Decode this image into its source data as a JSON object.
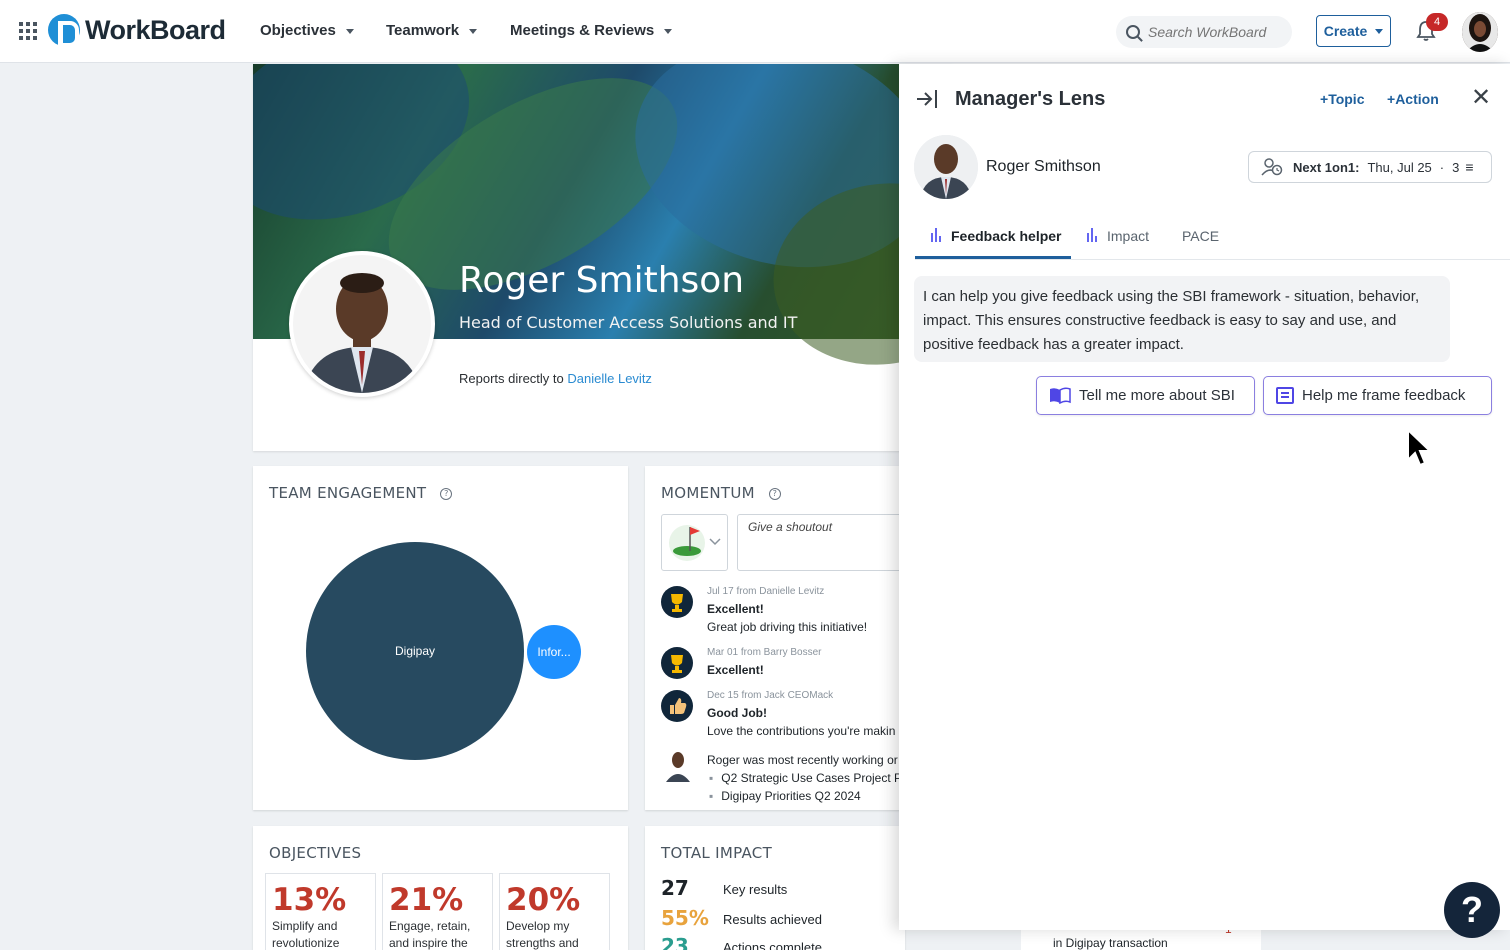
{
  "app": {
    "logo_text": "WorkBoard",
    "nav": [
      {
        "label": "Objectives"
      },
      {
        "label": "Teamwork"
      },
      {
        "label": "Meetings & Reviews"
      }
    ],
    "search_placeholder": "Search WorkBoard",
    "create_label": "Create",
    "notification_count": "4"
  },
  "profile": {
    "name": "Roger Smithson",
    "title": "Head of Customer Access Solutions and IT",
    "reports_prefix": "Reports directly to",
    "manager": "Danielle Levitz"
  },
  "engagement": {
    "title": "TEAM ENGAGEMENT",
    "help": "?",
    "bubbles": [
      {
        "label": "Digipay"
      },
      {
        "label": "Infor..."
      }
    ]
  },
  "momentum": {
    "title": "MOMENTUM",
    "help": "?",
    "shoutout_placeholder": "Give a shoutout",
    "feed": [
      {
        "meta": "Jul 17 from Danielle Levitz",
        "head": "Excellent!",
        "body": "Great job driving this initiative!",
        "icon": "trophy-icon"
      },
      {
        "meta": "Mar 01 from Barry Bosser",
        "head": "Excellent!",
        "body": "",
        "icon": "trophy-icon"
      },
      {
        "meta": "Dec 15 from Jack CEOMack",
        "head": "Good Job!",
        "body": "Love the contributions you're makin",
        "icon": "thumbs-up-icon"
      }
    ],
    "recent_intro": "Roger was most recently working or",
    "recent_items": [
      "Q2 Strategic Use Cases Project P",
      "Digipay Priorities Q2 2024"
    ]
  },
  "objectives": {
    "title": "OBJECTIVES",
    "items": [
      {
        "pct": "13%",
        "text1": "Simplify and",
        "text2": "revolutionize"
      },
      {
        "pct": "21%",
        "text1": "Engage, retain,",
        "text2": "and inspire the"
      },
      {
        "pct": "20%",
        "text1": "Develop my",
        "text2": "strengths and"
      }
    ]
  },
  "total_impact": {
    "title": "TOTAL IMPACT",
    "rows": [
      {
        "num": "27",
        "label": "Key results",
        "color": "#1d2328"
      },
      {
        "num": "55%",
        "label": "Results achieved",
        "color": "#e8a33d"
      },
      {
        "num": "23",
        "label": "Actions complete",
        "color": "#2a9d8f"
      }
    ]
  },
  "bottom_sliver": {
    "text": "in Digipay transaction",
    "count": "1"
  },
  "lens": {
    "title": "Manager's Lens",
    "topic_label": "Topic",
    "action_label": "Action",
    "person_name": "Roger Smithson",
    "next_label": "Next 1on1:",
    "next_date": "Thu, Jul 25",
    "next_count": "3",
    "tabs": [
      {
        "label": "Feedback helper",
        "active": true
      },
      {
        "label": "Impact",
        "active": false
      },
      {
        "label": "PACE",
        "active": false
      }
    ],
    "message": "I can help you give feedback using the SBI framework - situation, behavior, impact. This ensures constructive feedback is easy to say and use, and positive feedback has a greater impact.",
    "button_sbi": "Tell me more about SBI",
    "button_frame": "Help me frame feedback"
  },
  "colors": {
    "brand_blue": "#1f8fd6",
    "accent_navy": "#1e5f9c",
    "objective_red": "#c0392b",
    "ai_purple": "#6366f1"
  }
}
